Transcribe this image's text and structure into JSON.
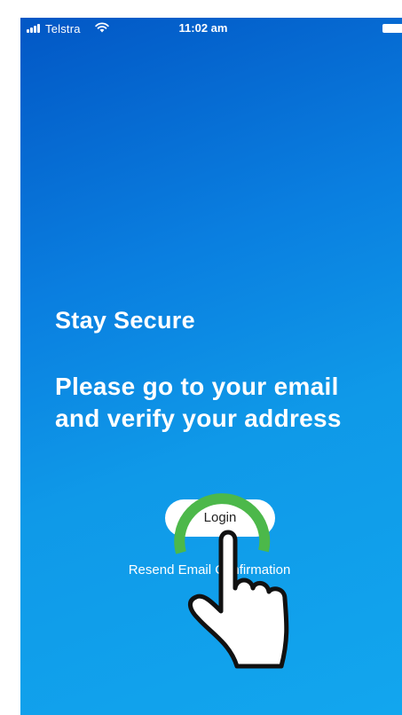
{
  "status_bar": {
    "carrier": "Telstra",
    "time": "11:02 am",
    "icons": [
      "signal-icon",
      "wifi-icon",
      "battery-icon"
    ]
  },
  "screen": {
    "title": "Stay Secure",
    "message": "Please go to your email and verify your address",
    "login_button": "Login",
    "resend_link": "Resend Email Confirmation"
  },
  "overlay": {
    "gesture": "tap-gesture-hand-icon",
    "ring_color": "#4cb84a"
  },
  "colors": {
    "gradient_top": "#0257c5",
    "gradient_bottom": "#12a6ee",
    "text": "#ffffff"
  }
}
